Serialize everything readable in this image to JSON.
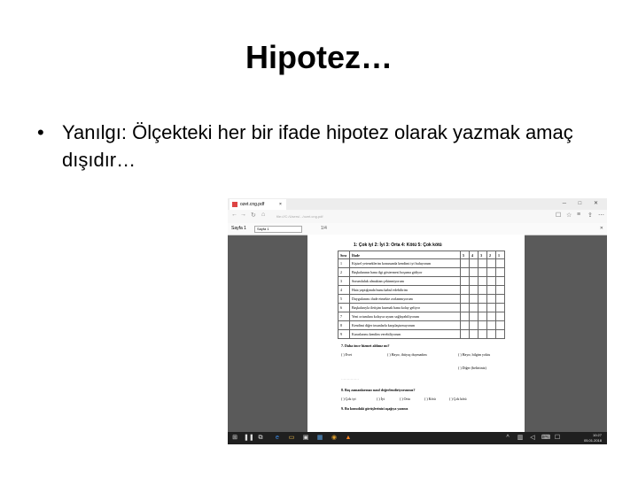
{
  "slide": {
    "title": "Hipotez…",
    "bullet_symbol": "•",
    "bullet_text": "Yanılgı: Ölçekteki her bir ifade hipotez olarak yazmak amaç dışıdır…"
  },
  "browser": {
    "tab_title": "ozet.cng.pdf",
    "tab_close": "×",
    "url": "file:///C:/Users/.../ozet.cng.pdf",
    "page_label": "Sayfa 1",
    "page_value": "Sayfa 1",
    "zoom_label": "1/4",
    "close_symbol": "✕"
  },
  "document": {
    "scale_header": "1: Çok iyi   2: İyi   3: Orta   4: Kötü   5: Çok kötü",
    "table_headers": [
      "Sıra",
      "İfade",
      "5",
      "4",
      "3",
      "2",
      "1"
    ],
    "rows": [
      {
        "no": "1",
        "text": "Kişisel yeteneklerim konusunda kendimi iyi buluyorum"
      },
      {
        "no": "2",
        "text": "Başkalarının bana ilgi göstermesi hoşuma gidiyor"
      },
      {
        "no": "3",
        "text": "Sorumluluk almaktan çekinmiyorum"
      },
      {
        "no": "4",
        "text": "Hata yaptığımda bunu kabul edebilirim"
      },
      {
        "no": "5",
        "text": "Duygularımı ifade etmekte zorlanmıyorum"
      },
      {
        "no": "6",
        "text": "Başkalarıyla iletişim kurmak bana kolay geliyor"
      },
      {
        "no": "7",
        "text": "Yeni ortamlara kolayca uyum sağlayabiliyorum"
      },
      {
        "no": "8",
        "text": "Kendimi diğer insanlarla karşılaştırmıyorum"
      },
      {
        "no": "9",
        "text": "Kararlarımı kendim verebiliyorum"
      }
    ],
    "section_7": "7. Daha önce hizmet aldınız mı?",
    "opts_7": [
      "( ) Evet",
      "( ) Hayır, ihtiyaç duymadım",
      "( ) Hayır, bilgim yoktu",
      "( ) Diğer (belirtiniz)"
    ],
    "dots": "……………",
    "section_8": "8. Boş zamanlarınızı nasıl değerlendiriyorsunuz?",
    "opts_8": [
      "( ) Çok iyi",
      "( ) İyi",
      "( ) Orta",
      "( ) Kötü",
      "( ) Çok kötü"
    ],
    "section_9": "9. Bu konudaki görüşlerinizi aşağıya yazınız"
  },
  "taskbar": {
    "time": "10:27",
    "date": "05.01.2018"
  }
}
